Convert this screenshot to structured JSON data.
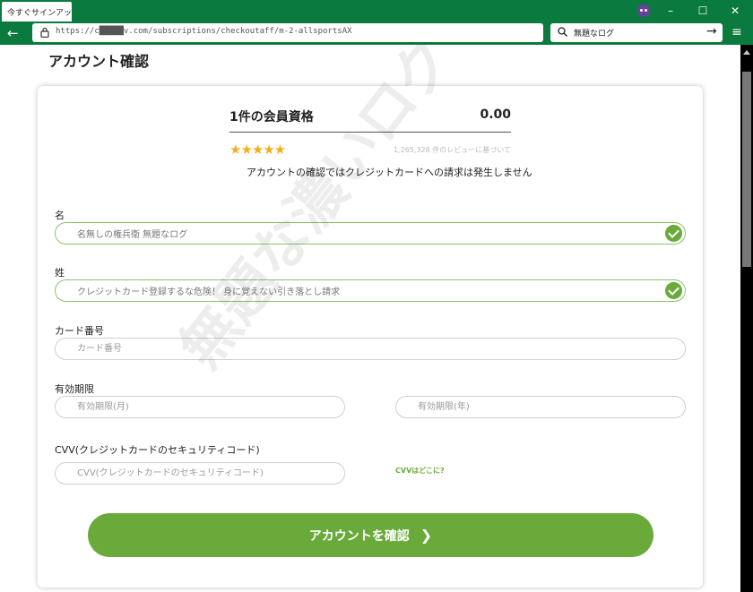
{
  "browser": {
    "tab_title": "今すぐサインアップ",
    "url": "https://c█████v.com/subscriptions/checkoutaff/m-2-allsportsAX",
    "search_text": "無題なログ"
  },
  "page": {
    "heading": "アカウント確認",
    "watermark": "無題な濃いログ"
  },
  "summary": {
    "plan_label": "1件の会員資格",
    "price": "0.00",
    "stars": "★★★★★",
    "reviews": "1,265,328 件のレビューに基づいて",
    "notice": "アカウントの確認ではクレジットカードへの請求は発生しません"
  },
  "form": {
    "first_name": {
      "label": "名",
      "value": "名無しの権兵衛 無題なログ"
    },
    "last_name": {
      "label": "姓",
      "value": "クレジットカード登録するな危険！ 身に覚えない引き落とし請求"
    },
    "card_number": {
      "label": "カード番号",
      "placeholder": "カード番号"
    },
    "expiry": {
      "label": "有効期限",
      "month_placeholder": "有効期限(月)",
      "year_placeholder": "有効期限(年)"
    },
    "cvv": {
      "label": "CVV(クレジットカードのセキュリティコード)",
      "placeholder": "CVV(クレジットカードのセキュリティコード)",
      "help_link": "CVVはどこに?"
    },
    "submit_label": "アカウントを確認"
  },
  "colors": {
    "accent": "#6aaa3a",
    "browser_chrome": "#0b7a3e",
    "stars": "#f2b01e"
  }
}
